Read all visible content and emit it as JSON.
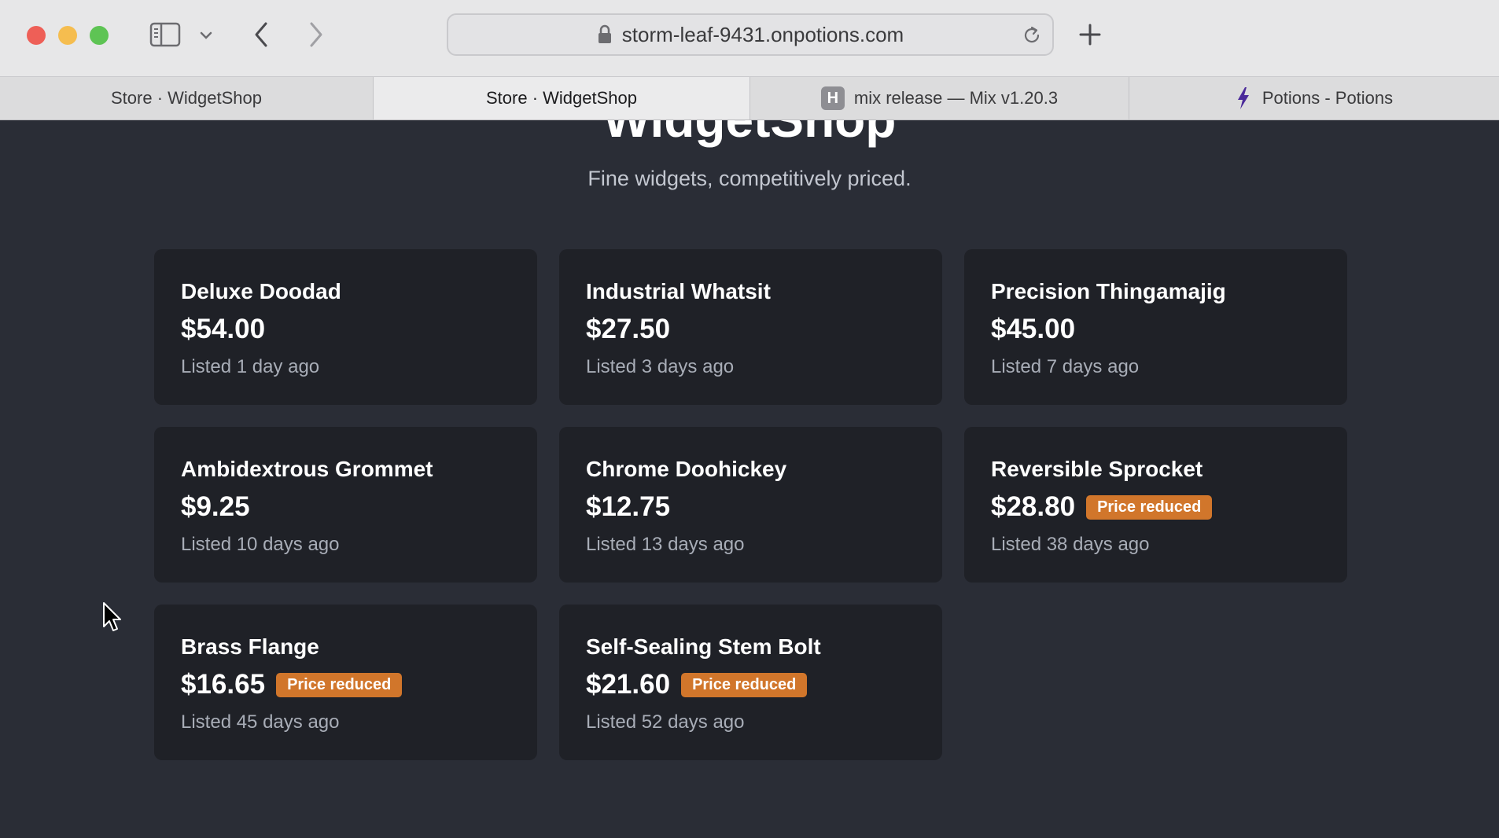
{
  "browser": {
    "url": "storm-leaf-9431.onpotions.com",
    "tabs": [
      {
        "label": "Store · WidgetShop",
        "active": false
      },
      {
        "label": "Store · WidgetShop",
        "active": true
      },
      {
        "label": "mix release — Mix v1.20.3",
        "favicon": "H",
        "active": false
      },
      {
        "label": "Potions - Potions",
        "favicon": "bolt-icon",
        "active": false
      }
    ]
  },
  "site": {
    "title": "WidgetShop",
    "subtitle": "Fine widgets, competitively priced."
  },
  "products": [
    {
      "name": "Deluxe Doodad",
      "price": "$54.00",
      "listed": "Listed 1 day ago",
      "badge": ""
    },
    {
      "name": "Industrial Whatsit",
      "price": "$27.50",
      "listed": "Listed 3 days ago",
      "badge": ""
    },
    {
      "name": "Precision Thingamajig",
      "price": "$45.00",
      "listed": "Listed 7 days ago",
      "badge": ""
    },
    {
      "name": "Ambidextrous Grommet",
      "price": "$9.25",
      "listed": "Listed 10 days ago",
      "badge": ""
    },
    {
      "name": "Chrome Doohickey",
      "price": "$12.75",
      "listed": "Listed 13 days ago",
      "badge": ""
    },
    {
      "name": "Reversible Sprocket",
      "price": "$28.80",
      "listed": "Listed 38 days ago",
      "badge": "Price reduced"
    },
    {
      "name": "Brass Flange",
      "price": "$16.65",
      "listed": "Listed 45 days ago",
      "badge": "Price reduced"
    },
    {
      "name": "Self-Sealing Stem Bolt",
      "price": "$21.60",
      "listed": "Listed 52 days ago",
      "badge": "Price reduced"
    }
  ],
  "colors": {
    "page_bg": "#2a2d36",
    "card_bg": "#1f2127",
    "badge_bg": "#d1762b"
  }
}
